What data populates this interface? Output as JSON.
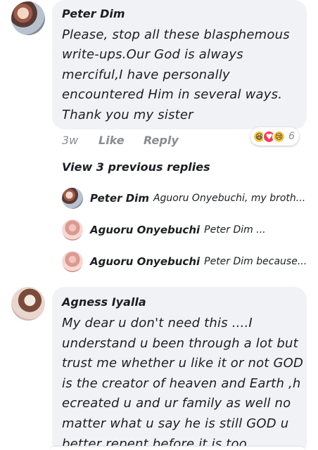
{
  "comment1": {
    "author": "Peter Dim",
    "lines": [
      "Please, stop all these blasphemous",
      "write-ups.Our God is always",
      "merciful,I have personally",
      "encountered Him in several ways.",
      "Thank you my sister"
    ],
    "time": "3w",
    "like_label": "Like",
    "reply_label": "Reply",
    "reactions": [
      "haha",
      "love",
      "sad"
    ],
    "reaction_count": "6"
  },
  "replies": {
    "view_previous_label": "View 3 previous replies",
    "items": [
      {
        "author": "Peter Dim",
        "snippet": "Aguoru Onyebuchi, my broth...",
        "avatar": "peter"
      },
      {
        "author": "Aguoru Onyebuchi",
        "snippet": "Peter Dim ...",
        "avatar": "aguoru"
      },
      {
        "author": "Aguoru Onyebuchi",
        "snippet": "Peter Dim because...",
        "avatar": "aguoru"
      }
    ]
  },
  "comment2": {
    "author": "Agness Iyalla",
    "lines": [
      "My dear u don't need this ....I",
      "understand u been through a lot but",
      "trust me whether u like it or not GOD",
      "is the creator of heaven and Earth ,h",
      "ecreated u and ur family as well no",
      "matter what u say he is still GOD u",
      "better repent before it is too"
    ]
  },
  "colors": {
    "bubble": "#f0f2f5",
    "meta": "#8a8d91",
    "love": "#f33e58",
    "haha": "#f7c948"
  }
}
